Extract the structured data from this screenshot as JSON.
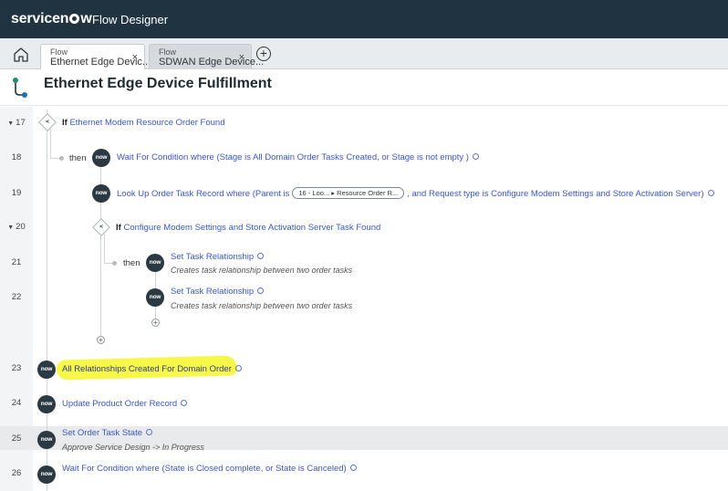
{
  "topbar": {
    "brand_pre": "service",
    "brand_post": "w",
    "app_name": "Flow Designer"
  },
  "tabs": [
    {
      "kind": "Flow",
      "label": "Ethernet Edge Devic...",
      "close": "×"
    },
    {
      "kind": "Flow",
      "label": "SDWAN Edge Device...",
      "close": "×"
    }
  ],
  "add_tab": "+",
  "header": {
    "title": "Ethernet Edge Device Fulfillment"
  },
  "lines": [
    {
      "num": "17",
      "collapsible": true
    },
    {
      "num": "18"
    },
    {
      "num": "19"
    },
    {
      "num": "20",
      "collapsible": true
    },
    {
      "num": "21"
    },
    {
      "num": "22"
    },
    {
      "num": "23"
    },
    {
      "num": "24"
    },
    {
      "num": "25"
    },
    {
      "num": "26"
    }
  ],
  "steps": {
    "s17": {
      "keyword": "If",
      "text": "Ethernet Modem Resource Order Found"
    },
    "s18": {
      "then": "then",
      "text": "Wait For Condition where (Stage is All Domain Order Tasks Created, or Stage is not empty )"
    },
    "s19": {
      "text_pre": "Look Up Order Task Record where (Parent is",
      "pill": "16 - Loo... ▸ Resource Order R...",
      "text_post": ", and Request type is Configure Modem Settings and Store Activation Server)"
    },
    "s20": {
      "keyword": "If",
      "text": "Configure Modem Settings and Store Activation Server Task Found"
    },
    "s21": {
      "then": "then",
      "text": "Set Task Relationship",
      "sub": "Creates task relationship between two order tasks"
    },
    "s22": {
      "text": "Set Task Relationship",
      "sub": "Creates task relationship between two order tasks"
    },
    "s23": {
      "text": "All Relationships Created For Domain Order"
    },
    "s24": {
      "text": "Update Product Order Record"
    },
    "s25": {
      "text": "Set Order Task State",
      "sub": "Approve Service Design -> In Progress"
    },
    "s26": {
      "text": "Wait For Condition where (State is Closed complete, or State is Canceled)"
    }
  },
  "icons": {
    "now_label": "now",
    "if_symbol": "⪪"
  }
}
